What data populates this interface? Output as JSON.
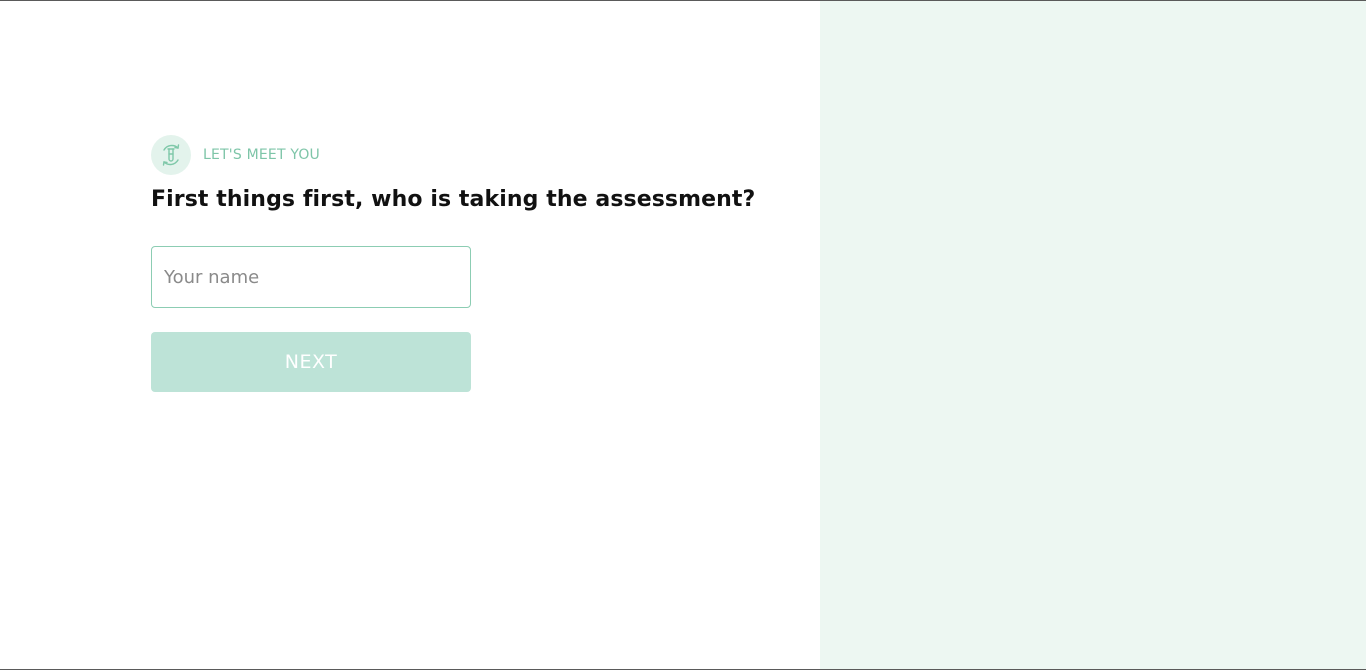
{
  "colors": {
    "accent": "#7fc8a9",
    "accent_light_bg": "#e3f3ec",
    "input_border": "#8ccdb3",
    "button_bg": "#bde3d7",
    "right_panel_bg": "#edf7f2",
    "eyebrow_text": "#7ec5a8"
  },
  "intro": {
    "icon": "test-tube-cycle-icon",
    "eyebrow": "LET'S MEET YOU",
    "question": "First things first, who is taking the assessment?"
  },
  "form": {
    "name_placeholder": "Your name",
    "name_value": "",
    "next_label": "NEXT"
  }
}
